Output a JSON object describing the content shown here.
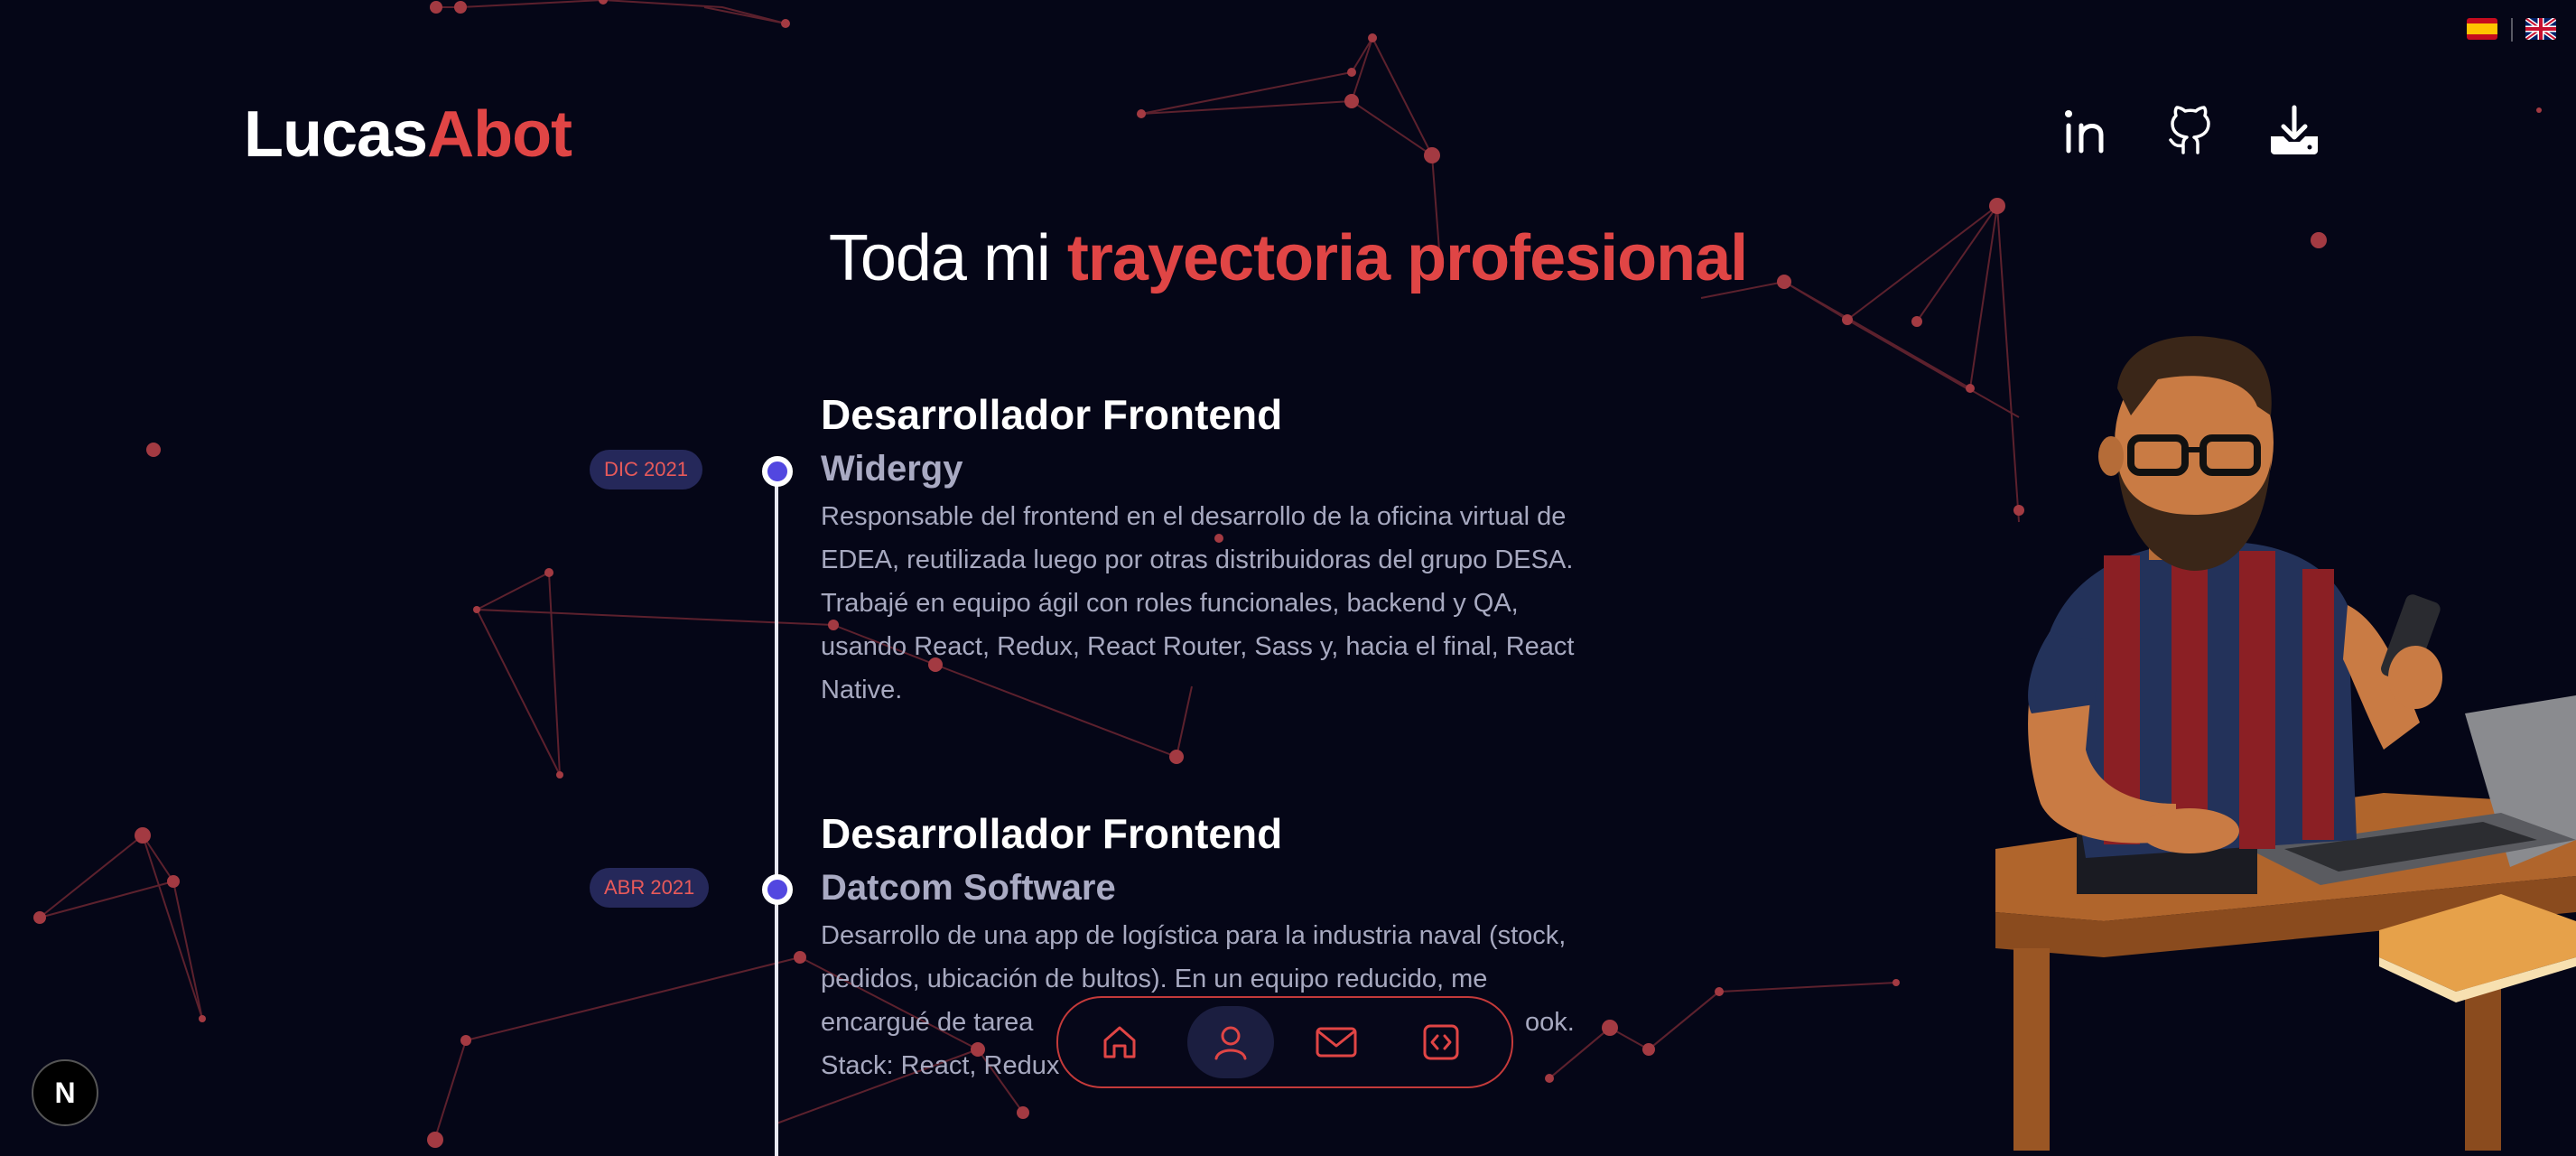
{
  "header": {
    "logo_first": "Lucas",
    "logo_second": "Abot",
    "social": [
      {
        "name": "linkedin-icon"
      },
      {
        "name": "github-icon"
      },
      {
        "name": "download-icon"
      }
    ],
    "languages": [
      "es",
      "en"
    ]
  },
  "hero": {
    "title_plain": "Toda mi ",
    "title_accent": "trayectoria profesional"
  },
  "timeline": [
    {
      "date": "DIC 2021",
      "role": "Desarrollador Frontend",
      "company": "Widergy",
      "description_lines": [
        "Responsable del frontend en el desarrollo de la oficina virtual de",
        "EDEA, reutilizada luego por otras distribuidoras del grupo DESA.",
        "Trabajé en equipo ágil con roles funcionales, backend y QA,",
        "usando React, Redux, React Router, Sass y, hacia el final, React",
        "Native."
      ]
    },
    {
      "date": "ABR 2021",
      "role": "Desarrollador Frontend",
      "company": "Datcom Software",
      "description_lines": [
        "Desarrollo de una app de logística para la industria naval (stock,",
        "pedidos, ubicación de bultos). En un equipo reducido, me",
        "encargué de tarea",
        "Stack: React, Redux"
      ],
      "line3_tail": "ook."
    }
  ],
  "bottom_nav": {
    "items": [
      "home-icon",
      "user-icon",
      "mail-icon",
      "code-icon"
    ],
    "active_index": 1
  },
  "next_badge": "N",
  "colors": {
    "background": "#050617",
    "accent": "#e04545",
    "timeline_dot": "#5247e0",
    "date_badge_bg": "#25285a"
  }
}
